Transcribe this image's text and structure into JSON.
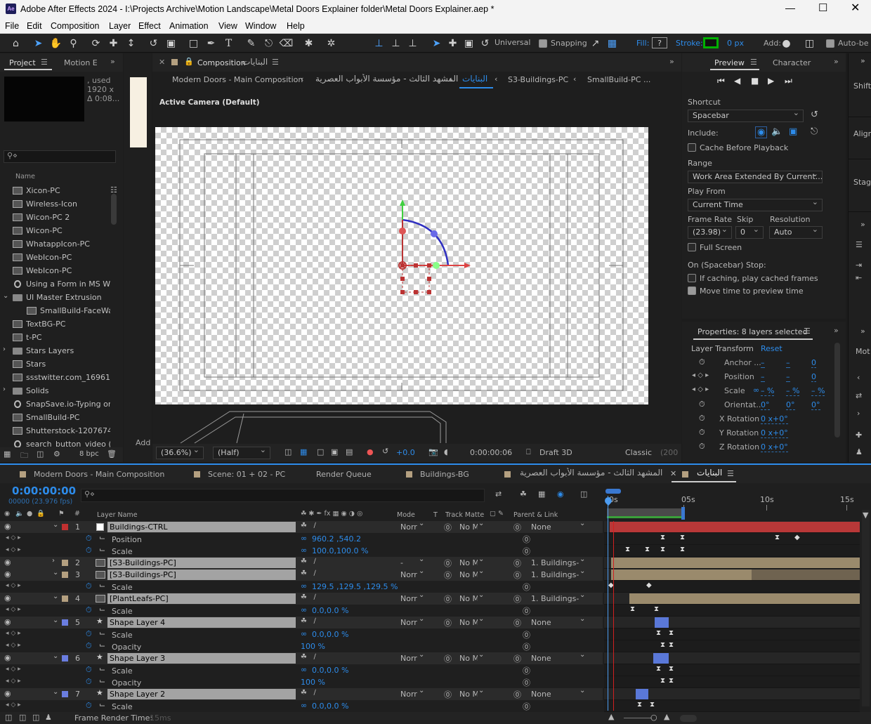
{
  "app": {
    "title": "Adobe After Effects 2024 - I:\\Projects Archive\\Motion Landscape\\Metal Doors Explainer folder\\Metal Doors Explainer.aep *",
    "icon": "Ae"
  },
  "menu": [
    "File",
    "Edit",
    "Composition",
    "Layer",
    "Effect",
    "Animation",
    "View",
    "Window",
    "Help"
  ],
  "toolbar": {
    "universal": "Universal",
    "snapping": "Snapping",
    "fill": "Fill:",
    "fill_q": "?",
    "stroke": "Stroke:",
    "stroke_px": "0 px",
    "add": "Add:",
    "auto": "Auto-be"
  },
  "project": {
    "tab": "Project",
    "tab2": "Motion E",
    "info": [
      ", used",
      "1920 x",
      "Δ 0:08..."
    ],
    "name_col": "Name",
    "bpc": "8 bpc",
    "add": "Add",
    "items": [
      {
        "label": "Xicon-PC",
        "type": "comp"
      },
      {
        "label": "Wireless-Icon",
        "type": "comp"
      },
      {
        "label": "Wicon-PC 2",
        "type": "comp"
      },
      {
        "label": "Wicon-PC",
        "type": "comp"
      },
      {
        "label": "WhatappIcon-PC",
        "type": "comp"
      },
      {
        "label": "WebIcon-PC",
        "type": "comp"
      },
      {
        "label": "WebIcon-PC",
        "type": "comp"
      },
      {
        "label": "Using a Form in MS Wo",
        "type": "file"
      },
      {
        "label": "UI Master Extrusion",
        "type": "folder"
      },
      {
        "label": "SmallBuild-FaceWal",
        "type": "comp"
      },
      {
        "label": "TextBG-PC",
        "type": "comp"
      },
      {
        "label": "t-PC",
        "type": "comp"
      },
      {
        "label": "Stars Layers",
        "type": "folder"
      },
      {
        "label": "Stars",
        "type": "comp"
      },
      {
        "label": "ssstwitter.com_169618",
        "type": "comp"
      },
      {
        "label": "Solids",
        "type": "folder"
      },
      {
        "label": "SnapSave.io-Typing on a",
        "type": "file"
      },
      {
        "label": "SmallBuild-PC",
        "type": "comp"
      },
      {
        "label": "Shutterstock-12076744",
        "type": "comp"
      },
      {
        "label": "search_button_video (O",
        "type": "file"
      }
    ]
  },
  "comp": {
    "tab": "Composition",
    "tab_name": "البنايات",
    "breadcrumb": [
      "Modern Doors - Main Composition",
      "المشهد الثالث - مؤسسة الأبواب العصرية",
      "البنايات",
      "S3-Buildings-PC",
      "SmallBuild-PC ..."
    ],
    "camera": "Active Camera (Default)",
    "zoom": "(36.6%)",
    "resolution": "(Half)",
    "exposure": "+0.0",
    "timecode": "0:00:00:06",
    "renderer": "Draft 3D",
    "classic": "Classic",
    "cut": "(200"
  },
  "preview": {
    "tab": "Preview",
    "tab2": "Character",
    "shortcut_label": "Shortcut",
    "shortcut": "Spacebar",
    "include": "Include:",
    "cache": "Cache Before Playback",
    "range_label": "Range",
    "range": "Work Area Extended By Current...",
    "playfrom_label": "Play From",
    "playfrom": "Current Time",
    "fr_label": "Frame Rate",
    "skip_label": "Skip",
    "res_label": "Resolution",
    "fr": "(23.98)",
    "skip": "0",
    "res": "Auto",
    "fullscreen": "Full Screen",
    "stop_label": "On (Spacebar) Stop:",
    "stop1": "If caching, play cached frames",
    "stop2": "Move time to preview time"
  },
  "right_strip": [
    "Shift",
    "Align",
    "Stag",
    "Mot"
  ],
  "properties": {
    "title": "Properties: 8 layers selected",
    "section": "Layer Transform",
    "reset": "Reset",
    "rows": [
      {
        "label": "Anchor ...",
        "v": [
          "–",
          "–",
          "0"
        ]
      },
      {
        "label": "Position",
        "v": [
          "–",
          "–",
          "0"
        ]
      },
      {
        "label": "Scale",
        "v": [
          "– %",
          "– %",
          "– %"
        ]
      },
      {
        "label": "Orientat...",
        "v": [
          "0°",
          "0°",
          "0°"
        ]
      },
      {
        "label": "X Rotation",
        "v": [
          "0 x+0°"
        ]
      },
      {
        "label": "Y Rotation",
        "v": [
          "0 x+0°"
        ]
      },
      {
        "label": "Z Rotation",
        "v": [
          "0 x+0°"
        ]
      }
    ]
  },
  "timeline": {
    "tabs": [
      "Modern Doors - Main Composition",
      "Scene: 01 + 02 - PC",
      "Render Queue",
      "Buildings-BG",
      "المشهد الثالث - مؤسسة الأبواب العصرية",
      "البنايات"
    ],
    "time": "0:00:00:00",
    "frames": "00000 (23.976 fps)",
    "cols": {
      "layer": "Layer Name",
      "mode": "Mode",
      "t": "T",
      "matte": "Track Matte",
      "parent": "Parent & Link"
    },
    "ruler": [
      "0s",
      "05s",
      "10s",
      "15s"
    ],
    "footer": "Frame Render Time:",
    "footer_val": "15ms",
    "rows": [
      {
        "kind": "layer",
        "num": "1",
        "name": "Buildings-CTRL",
        "color": "#c03030",
        "mode": "Norr",
        "matte": "No M",
        "parent": "None",
        "icon": "null"
      },
      {
        "kind": "prop",
        "name": "Position",
        "value": "960.2 ,540.2"
      },
      {
        "kind": "prop",
        "name": "Scale",
        "value": "100.0,100.0 %"
      },
      {
        "kind": "layer",
        "num": "2",
        "name": "[S3-Buildings-PC]",
        "color": "#b4a080",
        "mode": "-",
        "matte": "No M",
        "parent": "1. Buildings-C",
        "icon": "comp"
      },
      {
        "kind": "layer",
        "num": "3",
        "name": "[S3-Buildings-PC]",
        "color": "#b4a080",
        "mode": "Norr",
        "matte": "No M",
        "parent": "1. Buildings-C",
        "icon": "comp"
      },
      {
        "kind": "prop",
        "name": "Scale",
        "value": "129.5 ,129.5 ,129.5 %"
      },
      {
        "kind": "layer",
        "num": "4",
        "name": "[PlantLeafs-PC]",
        "color": "#b4a080",
        "mode": "Norr",
        "matte": "No M",
        "parent": "1. Buildings-C",
        "icon": "comp"
      },
      {
        "kind": "prop",
        "name": "Scale",
        "value": "0.0,0.0 %"
      },
      {
        "kind": "layer",
        "num": "5",
        "name": "Shape Layer 4",
        "color": "#6a7de0",
        "mode": "Norr",
        "matte": "No M",
        "parent": "None",
        "icon": "star"
      },
      {
        "kind": "prop",
        "name": "Scale",
        "value": "0.0,0.0 %"
      },
      {
        "kind": "prop",
        "name": "Opacity",
        "value": "100 %"
      },
      {
        "kind": "layer",
        "num": "6",
        "name": "Shape Layer 3",
        "color": "#6a7de0",
        "mode": "Norr",
        "matte": "No M",
        "parent": "None",
        "icon": "star"
      },
      {
        "kind": "prop",
        "name": "Scale",
        "value": "0.0,0.0 %"
      },
      {
        "kind": "prop",
        "name": "Opacity",
        "value": "100 %"
      },
      {
        "kind": "layer",
        "num": "7",
        "name": "Shape Layer 2",
        "color": "#6a7de0",
        "mode": "Norr",
        "matte": "No M",
        "parent": "None",
        "icon": "star"
      },
      {
        "kind": "prop",
        "name": "Scale",
        "value": "0.0,0.0 %"
      }
    ]
  }
}
